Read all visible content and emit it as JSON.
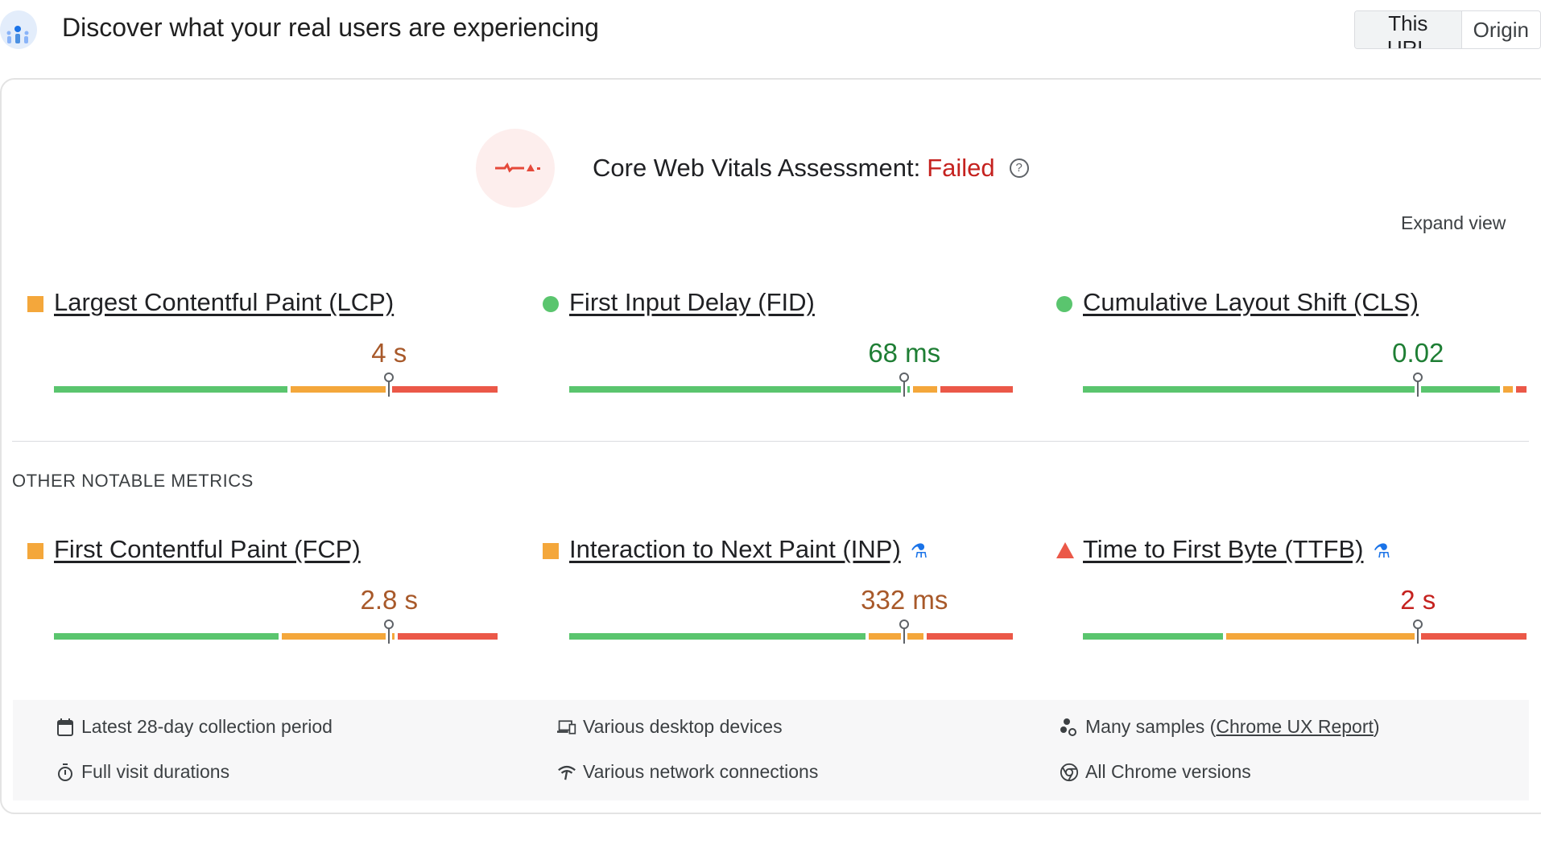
{
  "header": {
    "title": "Discover what your real users are experiencing",
    "scope_tabs": [
      {
        "label": "This URL",
        "active": true
      },
      {
        "label": "Origin",
        "active": false
      }
    ]
  },
  "assessment": {
    "label": "Core Web Vitals Assessment:",
    "status": "Failed",
    "status_color": "#c5221f",
    "expand_label": "Expand view"
  },
  "colors": {
    "good": "#5ac56e",
    "needs_improvement": "#f4a73b",
    "poor": "#eb5848"
  },
  "core_metrics": [
    {
      "name": "Largest Contentful Paint (LCP)",
      "value": "4 s",
      "rating": "needs-improvement",
      "value_color": "#a8592a",
      "distribution_pct": [
        53,
        22,
        25
      ],
      "p75_pct": 75,
      "experimental": false
    },
    {
      "name": "First Input Delay (FID)",
      "value": "68 ms",
      "rating": "good",
      "value_color": "#1e7e34",
      "distribution_pct": [
        77,
        6,
        17
      ],
      "p75_pct": 75,
      "experimental": false
    },
    {
      "name": "Cumulative Layout Shift (CLS)",
      "value": "0.02",
      "rating": "good",
      "value_color": "#1e7e34",
      "distribution_pct": [
        94,
        3,
        3
      ],
      "p75_pct": 75,
      "experimental": false
    }
  ],
  "other_heading": "OTHER NOTABLE METRICS",
  "other_metrics": [
    {
      "name": "First Contentful Paint (FCP)",
      "value": "2.8 s",
      "rating": "needs-improvement",
      "value_color": "#a8592a",
      "distribution_pct": [
        51,
        26,
        23
      ],
      "p75_pct": 75,
      "experimental": false
    },
    {
      "name": "Interaction to Next Paint (INP)",
      "value": "332 ms",
      "rating": "needs-improvement",
      "value_color": "#a8592a",
      "distribution_pct": [
        67,
        13,
        20
      ],
      "p75_pct": 75,
      "experimental": true
    },
    {
      "name": "Time to First Byte (TTFB)",
      "value": "2 s",
      "rating": "poor",
      "value_color": "#c5221f",
      "distribution_pct": [
        32,
        43,
        25
      ],
      "p75_pct": 75,
      "experimental": true
    }
  ],
  "footer": {
    "items": [
      {
        "icon": "calendar-icon",
        "text": "Latest 28-day collection period"
      },
      {
        "icon": "devices-icon",
        "text": "Various desktop devices"
      },
      {
        "icon": "samples-icon",
        "text": "Many samples (",
        "link": "Chrome UX Report",
        "suffix": ")"
      },
      {
        "icon": "stopwatch-icon",
        "text": "Full visit durations"
      },
      {
        "icon": "network-icon",
        "text": "Various network connections"
      },
      {
        "icon": "chrome-icon",
        "text": "All Chrome versions"
      }
    ]
  }
}
